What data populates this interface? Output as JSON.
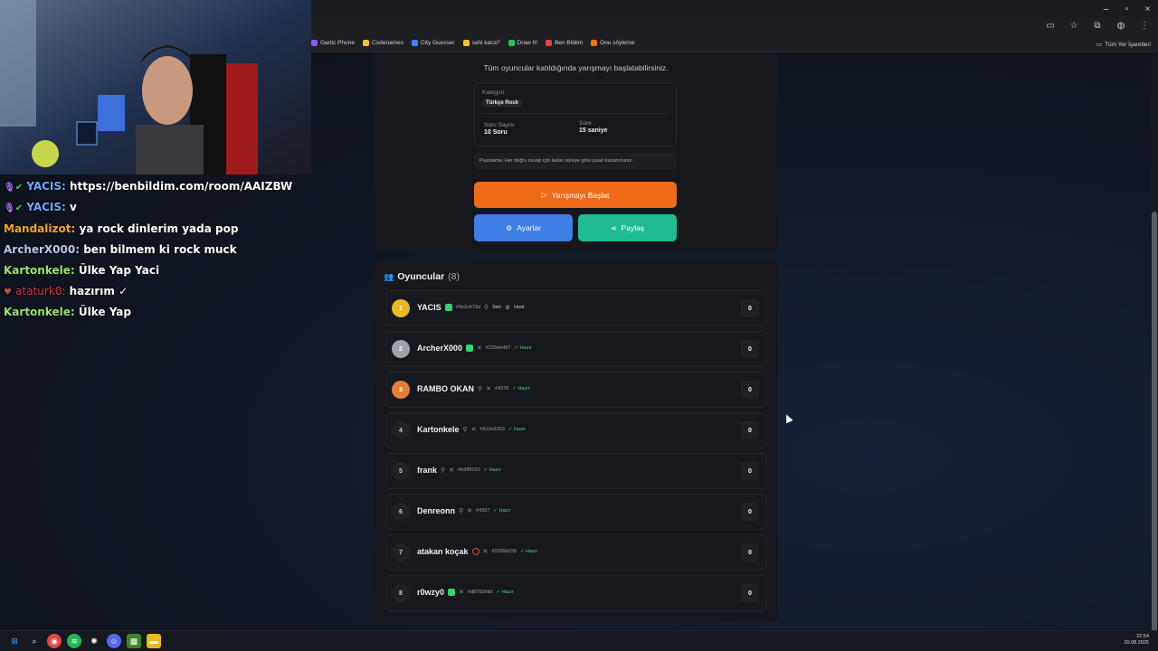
{
  "window": {
    "controls": [
      "–",
      "▫",
      "×"
    ]
  },
  "toolbar_icons": [
    "cast-icon",
    "star-icon",
    "extensions-icon",
    "profile-icon",
    "menu-icon"
  ],
  "bookmarks": [
    {
      "label": "Gartic Phone",
      "color": "#8e5cf5"
    },
    {
      "label": "Codenames",
      "color": "#f0c040"
    },
    {
      "label": "City Guesser",
      "color": "#3b82f6"
    },
    {
      "label": "sahi kaca?",
      "color": "#f5c518"
    },
    {
      "label": "Draw It!",
      "color": "#22c55e"
    },
    {
      "label": "Ben Bildim",
      "color": "#ef4444"
    },
    {
      "label": "Onu söyleme",
      "color": "#f97316"
    }
  ],
  "bookmarks_all": "Tüm Yer İşaretleri",
  "setup": {
    "description": "Tüm oyuncular katıldığında yarışmayı başlatabilirsiniz.",
    "category_label": "Kategori",
    "category_value": "Türkçe Rock",
    "questions_label": "Soru Sayısı",
    "questions_value": "10 Soru",
    "time_label": "Süre",
    "time_value": "15 saniye",
    "scoring_note": "Puanlama: Her doğru cevap için kalan süreye göre puan kazanırsınız.",
    "start_label": "Yarışmayı Başlat",
    "settings_label": "Ayarlar",
    "share_label": "Paylaş"
  },
  "players": {
    "title": "Oyuncular",
    "count": "(8)",
    "rows": [
      {
        "rank": "1",
        "name": "YACIS",
        "id": "#5b2c473d",
        "tags": [
          "Sen",
          "Host"
        ],
        "ready": "",
        "score": "0",
        "rank_color": "#e8b923"
      },
      {
        "rank": "2",
        "name": "ArcherX000",
        "id": "#225eb457",
        "tags": [],
        "ready": "Hazır",
        "score": "0",
        "rank_color": "#9ea3ab"
      },
      {
        "rank": "3",
        "name": "RAMBO OKAN",
        "id": "#4376",
        "tags": [],
        "ready": "Hazır",
        "score": "0",
        "rank_color": "#e5813a"
      },
      {
        "rank": "4",
        "name": "Kartonkele",
        "id": "#819c6359",
        "tags": [],
        "ready": "Hazır",
        "score": "0",
        "rank_color": "#1f2228"
      },
      {
        "rank": "5",
        "name": "frank",
        "id": "#b3f8f153",
        "tags": [],
        "ready": "Hazır",
        "score": "0",
        "rank_color": "#1f2228"
      },
      {
        "rank": "6",
        "name": "Denreonn",
        "id": "#4357",
        "tags": [],
        "ready": "Hazır",
        "score": "0",
        "rank_color": "#1f2228"
      },
      {
        "rank": "7",
        "name": "atakan koçak",
        "id": "#3289b228",
        "tags": [],
        "ready": "Hazır",
        "score": "0",
        "rank_color": "#1f2228"
      },
      {
        "rank": "8",
        "name": "r0wzy0",
        "id": "#d870b9dd",
        "tags": [],
        "ready": "Hazır",
        "score": "0",
        "rank_color": "#1f2228"
      }
    ]
  },
  "chat": [
    {
      "user": "YACIS:",
      "user_color": "#6ea8ff",
      "message": "https://benbildim.com/room/AAIZBW"
    },
    {
      "user": "YACIS:",
      "user_color": "#6ea8ff",
      "message": "v"
    },
    {
      "user": "Mandalizot:",
      "user_color": "#f5a623",
      "message": "ya rock dinlerim yada pop"
    },
    {
      "user": "ArcherX000:",
      "user_color": "#b3c7e6",
      "message": "ben bilmem ki rock muck"
    },
    {
      "user": "Kartonkele:",
      "user_color": "#9be26b",
      "message": "Ülke Yap Yaci"
    },
    {
      "user": "ataturk0:",
      "user_color": "#d33a3a",
      "message": "hazırım ✓"
    },
    {
      "user": "Kartonkele:",
      "user_color": "#9be26b",
      "message": "Ülke Yap"
    }
  ],
  "clock": {
    "time": "22:54",
    "date": "20.08.2025"
  }
}
